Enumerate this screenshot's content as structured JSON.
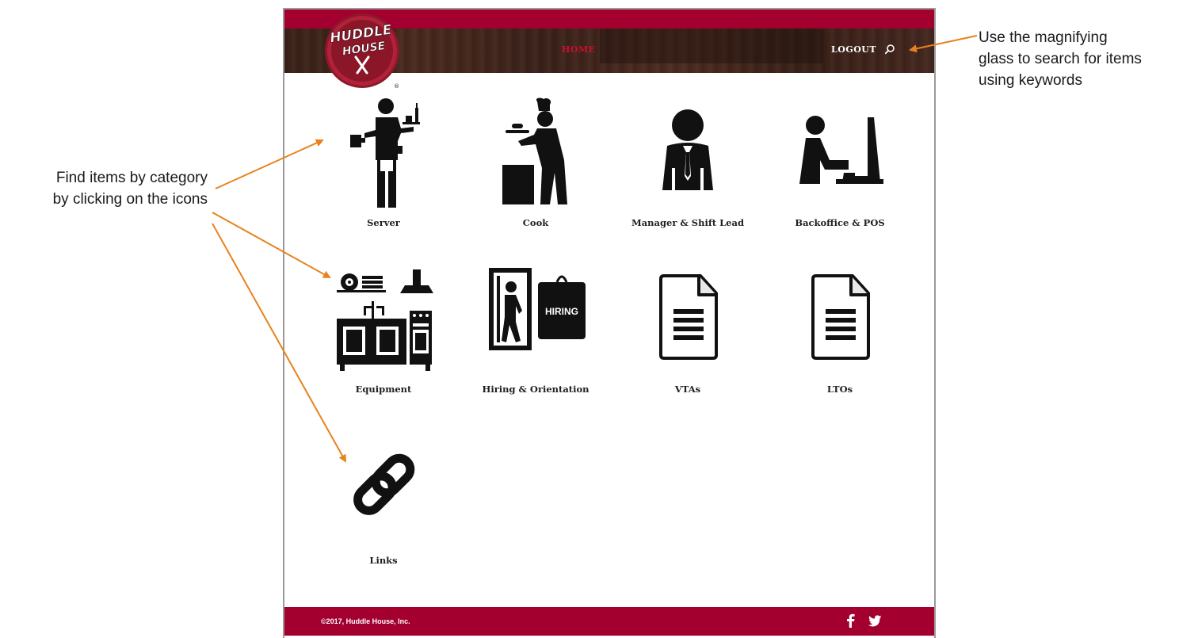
{
  "header": {
    "logo_text_line1": "HUDDLE",
    "logo_text_line2": "HOUSE",
    "nav_home": "HOME",
    "nav_logout": "LOGOUT",
    "search_icon": "search-icon"
  },
  "categories": [
    {
      "label": "Server",
      "icon": "server-icon"
    },
    {
      "label": "Cook",
      "icon": "cook-icon"
    },
    {
      "label": "Manager & Shift Lead",
      "icon": "manager-icon"
    },
    {
      "label": "Backoffice & POS",
      "icon": "backoffice-icon"
    },
    {
      "label": "Equipment",
      "icon": "equipment-icon"
    },
    {
      "label": "Hiring & Orientation",
      "icon": "hiring-icon",
      "badge": "HIRING"
    },
    {
      "label": "VTAs",
      "icon": "document-icon"
    },
    {
      "label": "LTOs",
      "icon": "document-icon"
    },
    {
      "label": "Links",
      "icon": "link-icon"
    }
  ],
  "footer": {
    "copyright": "©2017, Huddle House, Inc.",
    "social": [
      "facebook-icon",
      "twitter-icon"
    ]
  },
  "annotations": {
    "left_line1": "Find items by category",
    "left_line2": "by clicking on the icons",
    "right_line1": "Use the magnifying",
    "right_line2": "glass to search for items",
    "right_line3": "using keywords"
  },
  "colors": {
    "brand_red": "#a30030",
    "nav_home": "#c8102e",
    "wood": "#3a2218",
    "annotation_arrow": "#e8821e"
  }
}
